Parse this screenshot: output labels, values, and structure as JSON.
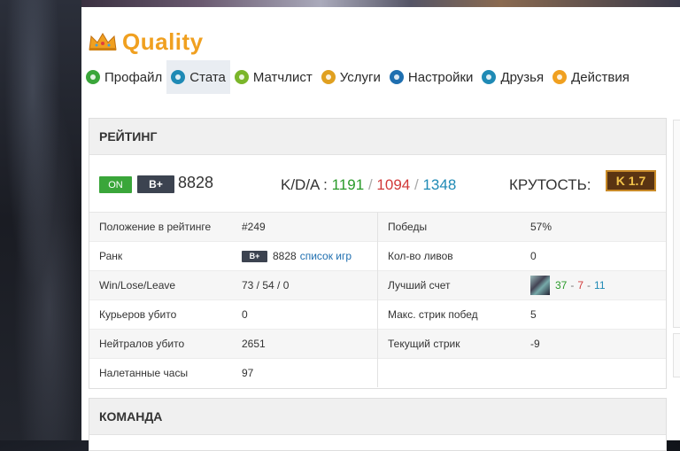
{
  "brand": {
    "name": "Quality"
  },
  "tabs": [
    {
      "label": "Профайл",
      "icon": "smile-icon",
      "color": "#3aa63a",
      "active": false
    },
    {
      "label": "Стата",
      "icon": "info-icon",
      "color": "#1f8ab5",
      "active": true
    },
    {
      "label": "Матчлист",
      "icon": "radiation-icon",
      "color": "#7bb62a",
      "active": false
    },
    {
      "label": "Услуги",
      "icon": "globe-icon",
      "color": "#e0a020",
      "active": false
    },
    {
      "label": "Настройки",
      "icon": "settings-icon",
      "color": "#1f6fb0",
      "active": false
    },
    {
      "label": "Друзья",
      "icon": "friends-icon",
      "color": "#1f8ab5",
      "active": false
    },
    {
      "label": "Действия",
      "icon": "list-icon",
      "color": "#f0a020",
      "active": false
    }
  ],
  "rating": {
    "title": "РЕЙТИНГ",
    "status": "ON",
    "rank_badge": "B+",
    "mmr": "8828",
    "kda_label": "K/D/A :",
    "kills": "1191",
    "deaths": "1094",
    "assists": "1348",
    "sep": "/",
    "coolness_label": "КРУТОСТЬ:",
    "coolness_value": "K 1.7"
  },
  "stats_left": [
    {
      "label": "Положение в рейтинге",
      "value": "#249"
    },
    {
      "label": "Ранк",
      "value": "8828",
      "badge": "B+",
      "link": "список игр"
    },
    {
      "label": "Win/Lose/Leave",
      "value": "73 / 54 / 0"
    },
    {
      "label": "Курьеров убито",
      "value": "0"
    },
    {
      "label": "Нейтралов убито",
      "value": "2651"
    },
    {
      "label": "Налетанные часы",
      "value": "97"
    }
  ],
  "stats_right": [
    {
      "label": "Победы",
      "value": "57%"
    },
    {
      "label": "Кол-во ливов",
      "value": "0"
    },
    {
      "label": "Лучший счет",
      "kills": "37",
      "deaths": "7",
      "assists": "11",
      "sep": "-"
    },
    {
      "label": "Макс. стрик побед",
      "value": "5"
    },
    {
      "label": "Текущий стрик",
      "value": "-9"
    }
  ],
  "team": {
    "title": "КОМАНДА"
  }
}
